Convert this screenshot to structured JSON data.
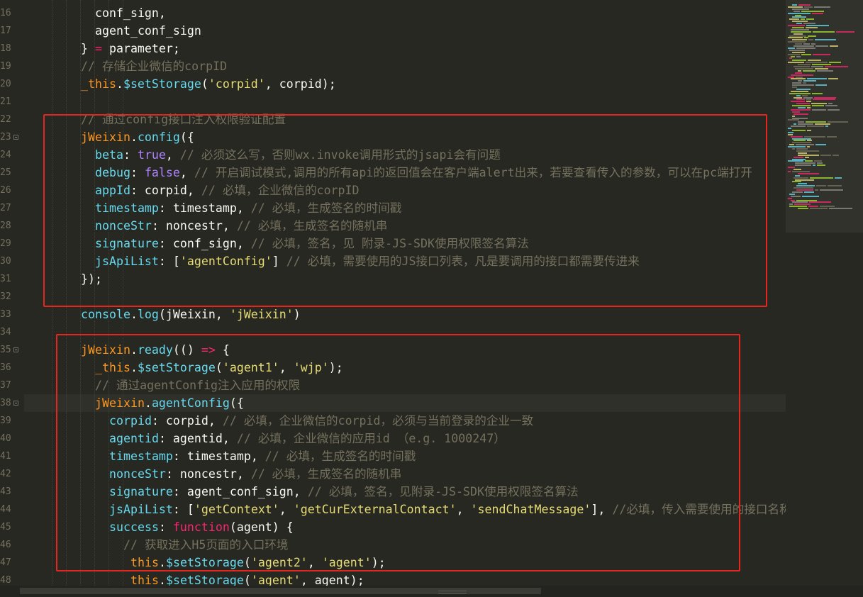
{
  "editor": {
    "theme_colors": {
      "background": "#272822",
      "keyword": "#f92672",
      "function": "#66d9ef",
      "string": "#e6db74",
      "number": "#ae81ff",
      "comment": "#75715e",
      "text": "#f8f8f2",
      "annotation_box": "#e5261f"
    },
    "lines": [
      {
        "num": "16",
        "indent": 4,
        "tokens": [
          {
            "t": "conf_sign,",
            "c": ""
          }
        ]
      },
      {
        "num": "17",
        "indent": 4,
        "tokens": [
          {
            "t": "agent_conf_sign",
            "c": ""
          }
        ]
      },
      {
        "num": "18",
        "indent": 3,
        "tokens": [
          {
            "t": "} ",
            "c": ""
          },
          {
            "t": "=",
            "c": "kw"
          },
          {
            "t": " parameter;",
            "c": ""
          }
        ]
      },
      {
        "num": "19",
        "indent": 3,
        "tokens": [
          {
            "t": "// 存储企业微信的corpID",
            "c": "cm"
          }
        ]
      },
      {
        "num": "20",
        "indent": 3,
        "tokens": [
          {
            "t": "_this",
            "c": "thisv"
          },
          {
            "t": ".",
            "c": ""
          },
          {
            "t": "$setStorage",
            "c": "fn"
          },
          {
            "t": "(",
            "c": ""
          },
          {
            "t": "'corpid'",
            "c": "str"
          },
          {
            "t": ", corpid);",
            "c": ""
          }
        ]
      },
      {
        "num": "21",
        "indent": 0,
        "tokens": []
      },
      {
        "num": "22",
        "indent": 3,
        "tokens": [
          {
            "t": "// 通过config接口注入权限验证配置",
            "c": "cm"
          }
        ]
      },
      {
        "num": "23",
        "indent": 3,
        "fold": true,
        "tokens": [
          {
            "t": "jWeixin",
            "c": "thisv"
          },
          {
            "t": ".",
            "c": ""
          },
          {
            "t": "config",
            "c": "fn"
          },
          {
            "t": "({",
            "c": ""
          }
        ]
      },
      {
        "num": "24",
        "indent": 4,
        "tokens": [
          {
            "t": "beta",
            "c": "fn"
          },
          {
            "t": ": ",
            "c": ""
          },
          {
            "t": "true",
            "c": "num"
          },
          {
            "t": ", ",
            "c": ""
          },
          {
            "t": "// 必须这么写，否则wx.invoke调用形式的jsapi会有问题",
            "c": "cm"
          }
        ]
      },
      {
        "num": "25",
        "indent": 4,
        "tokens": [
          {
            "t": "debug",
            "c": "fn"
          },
          {
            "t": ": ",
            "c": ""
          },
          {
            "t": "false",
            "c": "num"
          },
          {
            "t": ", ",
            "c": ""
          },
          {
            "t": "// 开启调试模式,调用的所有api的返回值会在客户端alert出来，若要查看传入的参数，可以在pc端打开",
            "c": "cm"
          }
        ]
      },
      {
        "num": "26",
        "indent": 4,
        "tokens": [
          {
            "t": "appId",
            "c": "fn"
          },
          {
            "t": ": corpid, ",
            "c": ""
          },
          {
            "t": "// 必填，企业微信的corpID",
            "c": "cm"
          }
        ]
      },
      {
        "num": "27",
        "indent": 4,
        "tokens": [
          {
            "t": "timestamp",
            "c": "fn"
          },
          {
            "t": ": timestamp, ",
            "c": ""
          },
          {
            "t": "// 必填，生成签名的时间戳",
            "c": "cm"
          }
        ]
      },
      {
        "num": "28",
        "indent": 4,
        "tokens": [
          {
            "t": "nonceStr",
            "c": "fn"
          },
          {
            "t": ": noncestr, ",
            "c": ""
          },
          {
            "t": "// 必填，生成签名的随机串",
            "c": "cm"
          }
        ]
      },
      {
        "num": "29",
        "indent": 4,
        "tokens": [
          {
            "t": "signature",
            "c": "fn"
          },
          {
            "t": ": conf_sign, ",
            "c": ""
          },
          {
            "t": "// 必填，签名，见 附录-JS-SDK使用权限签名算法",
            "c": "cm"
          }
        ]
      },
      {
        "num": "30",
        "indent": 4,
        "tokens": [
          {
            "t": "jsApiList",
            "c": "fn"
          },
          {
            "t": ": [",
            "c": ""
          },
          {
            "t": "'agentConfig'",
            "c": "str"
          },
          {
            "t": "] ",
            "c": ""
          },
          {
            "t": "// 必填，需要使用的JS接口列表，凡是要调用的接口都需要传进来",
            "c": "cm"
          }
        ]
      },
      {
        "num": "31",
        "indent": 3,
        "tokens": [
          {
            "t": "});",
            "c": ""
          }
        ]
      },
      {
        "num": "32",
        "indent": 0,
        "tokens": []
      },
      {
        "num": "33",
        "indent": 3,
        "tokens": [
          {
            "t": "console",
            "c": "fn"
          },
          {
            "t": ".",
            "c": ""
          },
          {
            "t": "log",
            "c": "fn"
          },
          {
            "t": "(jWeixin, ",
            "c": ""
          },
          {
            "t": "'jWeixin'",
            "c": "str"
          },
          {
            "t": ")",
            "c": ""
          }
        ]
      },
      {
        "num": "34",
        "indent": 0,
        "tokens": []
      },
      {
        "num": "35",
        "indent": 3,
        "fold": true,
        "tokens": [
          {
            "t": "jWeixin",
            "c": "thisv"
          },
          {
            "t": ".",
            "c": ""
          },
          {
            "t": "ready",
            "c": "fn"
          },
          {
            "t": "(() ",
            "c": ""
          },
          {
            "t": "=>",
            "c": "kw"
          },
          {
            "t": " {",
            "c": ""
          }
        ]
      },
      {
        "num": "36",
        "indent": 4,
        "tokens": [
          {
            "t": "_this",
            "c": "thisv"
          },
          {
            "t": ".",
            "c": ""
          },
          {
            "t": "$setStorage",
            "c": "fn"
          },
          {
            "t": "(",
            "c": ""
          },
          {
            "t": "'agent1'",
            "c": "str"
          },
          {
            "t": ", ",
            "c": ""
          },
          {
            "t": "'wjp'",
            "c": "str"
          },
          {
            "t": ");",
            "c": ""
          }
        ]
      },
      {
        "num": "37",
        "indent": 4,
        "tokens": [
          {
            "t": "// 通过agentConfig注入应用的权限",
            "c": "cm"
          }
        ]
      },
      {
        "num": "38",
        "indent": 4,
        "fold": true,
        "active": true,
        "tokens": [
          {
            "t": "jWeixin",
            "c": "thisv"
          },
          {
            "t": ".",
            "c": ""
          },
          {
            "t": "agentConfig",
            "c": "fn"
          },
          {
            "t": "({",
            "c": ""
          }
        ]
      },
      {
        "num": "39",
        "indent": 5,
        "tokens": [
          {
            "t": "corpid",
            "c": "fn"
          },
          {
            "t": ": corpid, ",
            "c": ""
          },
          {
            "t": "// 必填，企业微信的corpid，必须与当前登录的企业一致",
            "c": "cm"
          }
        ]
      },
      {
        "num": "40",
        "indent": 5,
        "tokens": [
          {
            "t": "agentid",
            "c": "fn"
          },
          {
            "t": ": agentid, ",
            "c": ""
          },
          {
            "t": "// 必填，企业微信的应用id （e.g. 1000247）",
            "c": "cm"
          }
        ]
      },
      {
        "num": "41",
        "indent": 5,
        "tokens": [
          {
            "t": "timestamp",
            "c": "fn"
          },
          {
            "t": ": timestamp, ",
            "c": ""
          },
          {
            "t": "// 必填，生成签名的时间戳",
            "c": "cm"
          }
        ]
      },
      {
        "num": "42",
        "indent": 5,
        "tokens": [
          {
            "t": "nonceStr",
            "c": "fn"
          },
          {
            "t": ": noncestr, ",
            "c": ""
          },
          {
            "t": "// 必填，生成签名的随机串",
            "c": "cm"
          }
        ]
      },
      {
        "num": "43",
        "indent": 5,
        "tokens": [
          {
            "t": "signature",
            "c": "fn"
          },
          {
            "t": ": agent_conf_sign, ",
            "c": ""
          },
          {
            "t": "// 必填，签名，见附录-JS-SDK使用权限签名算法",
            "c": "cm"
          }
        ]
      },
      {
        "num": "44",
        "indent": 5,
        "tokens": [
          {
            "t": "jsApiList",
            "c": "fn"
          },
          {
            "t": ": [",
            "c": ""
          },
          {
            "t": "'getContext'",
            "c": "str"
          },
          {
            "t": ", ",
            "c": ""
          },
          {
            "t": "'getCurExternalContact'",
            "c": "str"
          },
          {
            "t": ", ",
            "c": ""
          },
          {
            "t": "'sendChatMessage'",
            "c": "str"
          },
          {
            "t": "], ",
            "c": ""
          },
          {
            "t": "//必填，传入需要使用的接口名称",
            "c": "cm"
          }
        ]
      },
      {
        "num": "45",
        "indent": 5,
        "tokens": [
          {
            "t": "success",
            "c": "fn"
          },
          {
            "t": ": ",
            "c": ""
          },
          {
            "t": "function",
            "c": "kw"
          },
          {
            "t": "(agent) {",
            "c": ""
          }
        ]
      },
      {
        "num": "46",
        "indent": 6,
        "tokens": [
          {
            "t": "// 获取进入H5页面的入口环境",
            "c": "cm"
          }
        ]
      },
      {
        "num": "47",
        "indent": 6,
        "pad": true,
        "tokens": [
          {
            "t": "this",
            "c": "thisv"
          },
          {
            "t": ".",
            "c": ""
          },
          {
            "t": "$setStorage",
            "c": "fn"
          },
          {
            "t": "(",
            "c": ""
          },
          {
            "t": "'agent2'",
            "c": "str"
          },
          {
            "t": ", ",
            "c": ""
          },
          {
            "t": "'agent'",
            "c": "str"
          },
          {
            "t": ");",
            "c": ""
          }
        ]
      },
      {
        "num": "48",
        "indent": 6,
        "pad": true,
        "tokens": [
          {
            "t": "this",
            "c": "thisv"
          },
          {
            "t": ".",
            "c": ""
          },
          {
            "t": "$setStorage",
            "c": "fn"
          },
          {
            "t": "(",
            "c": ""
          },
          {
            "t": "'agent'",
            "c": "str"
          },
          {
            "t": ", agent);",
            "c": ""
          }
        ]
      }
    ]
  }
}
